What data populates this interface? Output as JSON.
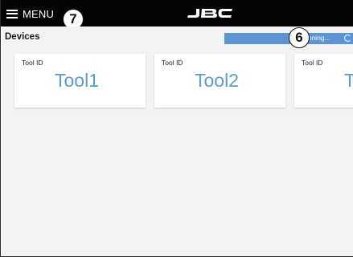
{
  "header": {
    "menu_label": "MENU",
    "logo_text": "JBC",
    "callout_menu": "7"
  },
  "devices": {
    "title": "Devices",
    "scan_status": "anning...",
    "callout_scan": "6"
  },
  "tools": [
    {
      "label": "Tool ID",
      "name": "Tool1"
    },
    {
      "label": "Tool ID",
      "name": "Tool2"
    },
    {
      "label": "Tool ID",
      "name": "To"
    }
  ],
  "colors": {
    "header_bg": "#050505",
    "content_bg": "#f3f3f3",
    "scan_bar": "#5b93d3",
    "tool_name": "#5b9bd5"
  }
}
